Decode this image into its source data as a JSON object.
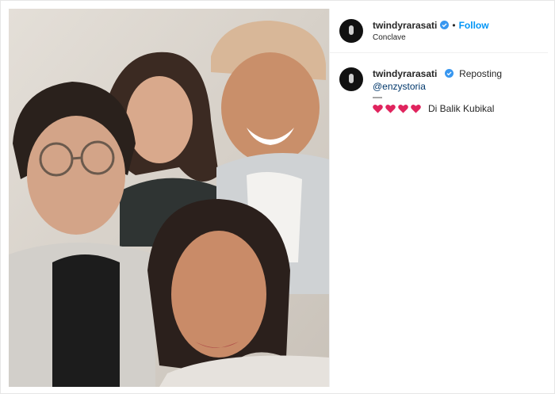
{
  "post": {
    "username": "twindyrarasati",
    "separator": "•",
    "follow_label": "Follow",
    "location": "Conclave",
    "caption": {
      "username": "twindyrarasati",
      "text": "Reposting",
      "mention": "@enzystoria",
      "dash": "—",
      "hearts_count": 4,
      "hearts_text": "Di Balik Kubikal"
    }
  },
  "colors": {
    "link_blue": "#0095f6",
    "mention_blue": "#00376b",
    "heart_red": "#e0245e",
    "verified_blue": "#3897f0"
  }
}
